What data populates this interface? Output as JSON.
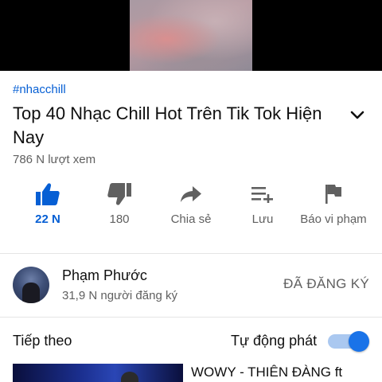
{
  "video": {
    "hashtag": "#nhacchill",
    "title": "Top 40 Nhạc Chill Hot Trên Tik Tok Hiện Nay",
    "views": "786 N lượt xem"
  },
  "actions": {
    "like_count": "22 N",
    "dislike_count": "180",
    "share_label": "Chia sẻ",
    "save_label": "Lưu",
    "report_label": "Báo vi phạm"
  },
  "channel": {
    "name": "Phạm Phước",
    "subscribers": "31,9 N người đăng ký",
    "subscribe_state": "ĐÃ ĐĂNG KÝ"
  },
  "up_next": {
    "heading": "Tiếp theo",
    "autoplay_label": "Tự động phát",
    "autoplay_on": true,
    "next_video_title": "WOWY - THIÊN ĐÀNG ft"
  },
  "colors": {
    "accent": "#065fd4",
    "toggle_knob": "#1a73e8",
    "secondary_text": "#606060"
  }
}
